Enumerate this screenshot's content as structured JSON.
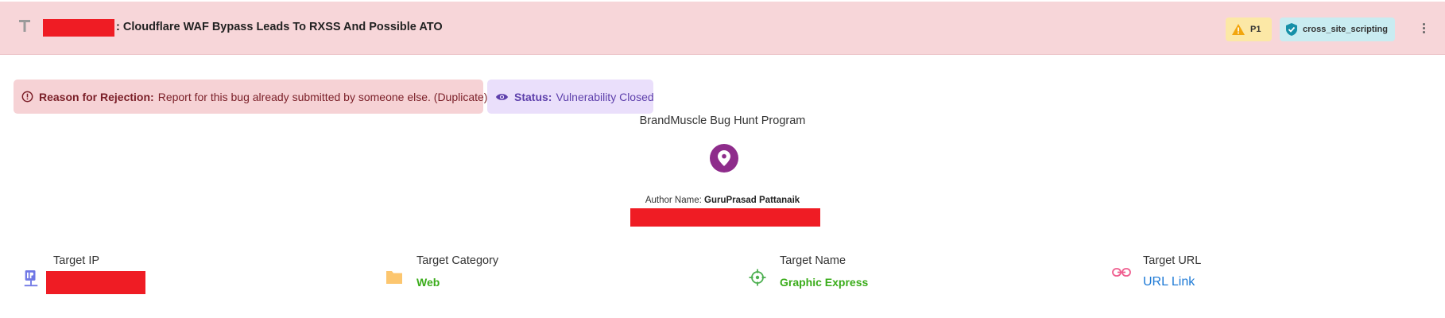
{
  "header": {
    "title": ": Cloudflare WAF Bypass Leads To RXSS And Possible ATO",
    "priority": "P1",
    "tag": "cross_site_scripting"
  },
  "alerts": {
    "rejection_label": "Reason for Rejection:",
    "rejection_text": "Report for this bug already submitted by someone else. (Duplicate)",
    "status_label": "Status:",
    "status_text": "Vulnerability Closed"
  },
  "program": {
    "name": "BrandMuscle Bug Hunt Program",
    "author_label": "Author Name:",
    "author_name": "GuruPrasad Pattanaik"
  },
  "targets": [
    {
      "label": "Target IP",
      "value": ""
    },
    {
      "label": "Target Category",
      "value": "Web"
    },
    {
      "label": "Target Name",
      "value": "Graphic Express"
    },
    {
      "label": "Target URL",
      "value": "URL Link"
    }
  ],
  "colors": {
    "header_bg": "#f7d6d9",
    "rejection_bg": "#f6d2d5",
    "status_bg": "#eadffb",
    "pin_bg": "#8e2c8b",
    "value_green": "#3aac1a",
    "link_blue": "#1e7ad6",
    "redaction": "#ef1c24"
  },
  "icons": {
    "title": "text-t-icon",
    "priority": "warning-triangle-icon",
    "tag": "shield-check-icon",
    "menu": "kebab-menu-icon",
    "rejection": "alert-circle-icon",
    "status": "eye-icon",
    "program": "map-pin-icon",
    "target_ip": "ip-network-icon",
    "target_category": "folder-icon",
    "target_name": "crosshair-icon",
    "target_url": "link-icon"
  }
}
